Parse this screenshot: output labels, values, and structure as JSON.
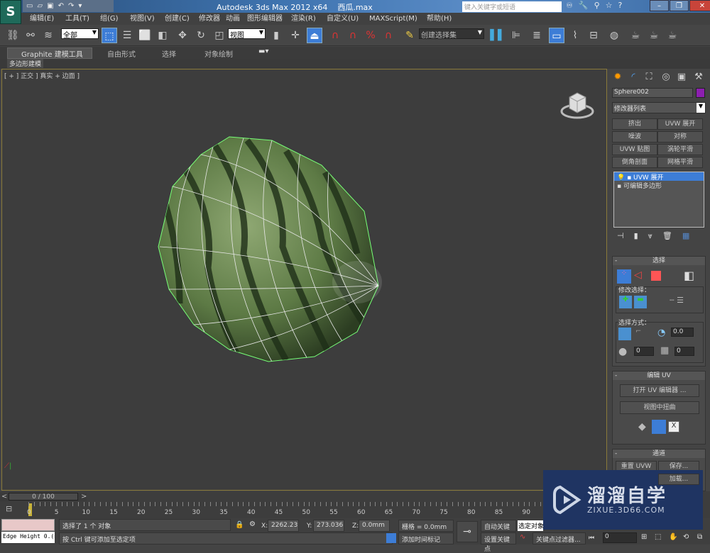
{
  "titlebar": {
    "title": "Autodesk 3ds Max  2012 x64",
    "file": "西瓜.max",
    "search_placeholder": "键入关键字或短语",
    "app_icon": "S"
  },
  "menu": [
    "编辑(E)",
    "工具(T)",
    "组(G)",
    "视图(V)",
    "创建(C)",
    "修改器",
    "动画",
    "图形编辑器",
    "渲染(R)",
    "自定义(U)",
    "MAXScript(M)",
    "帮助(H)"
  ],
  "toolbar": {
    "selection_filter": "全部",
    "reference_coord": "视图",
    "named_selection": "创建选择集"
  },
  "ribbon": {
    "tabs": [
      "Graphite 建模工具",
      "自由形式",
      "选择",
      "对象绘制"
    ],
    "subtab": "多边形建模"
  },
  "viewport": {
    "label": "[ + ] 正交 ] 真实 + 边面 ]"
  },
  "command_panel": {
    "object_name": "Sphere002",
    "object_color": "#8c1fb0",
    "modifier_list": "修改器列表",
    "modifier_buttons": [
      "挤出",
      "UVW 展开",
      "噪波",
      "对称",
      "UVW 贴图",
      "涡轮平滑",
      "倒角剖面",
      "网格平滑"
    ],
    "stack": [
      {
        "label": "UVW 展开",
        "selected": true
      },
      {
        "label": "可编辑多边形",
        "selected": false
      }
    ],
    "selection": {
      "title": "选择",
      "modify_label": "修改选择：",
      "method_label": "选择方式：",
      "angle": "0.0",
      "spin1": "0",
      "spin2": "0"
    },
    "edit_uv": {
      "title": "编辑 UV",
      "open_editor": "打开 UV 编辑器 ...",
      "tweak": "视图中扭曲"
    },
    "channel": {
      "title": "通道",
      "reset": "重置 UVW",
      "save": "保存...",
      "load": "加载..."
    }
  },
  "timeline": {
    "frame": "0 / 100",
    "prev": "<",
    "next": ">",
    "ticks": [
      "0",
      "5",
      "10",
      "15",
      "20",
      "25",
      "30",
      "35",
      "40",
      "45",
      "50",
      "55",
      "60",
      "65",
      "70",
      "75",
      "80",
      "85",
      "90"
    ]
  },
  "status": {
    "script_text": "Edge Height 0.(",
    "message": "选择了 1 个 对象",
    "hint": "按 Ctrl 键可添加至选定项",
    "x": "2262.239m",
    "y": "273.036mm",
    "z": "0.0mm",
    "grid": "栅格 = 0.0mm",
    "add_time_tag": "添加时间标记",
    "auto_key": "自动关键点",
    "set_key": "设置关键点",
    "key_mode": "选定对象",
    "key_filters": "关键点过滤器...",
    "frame_value": "0"
  },
  "watermark": {
    "brand": "溜溜自学",
    "url": "ZIXUE.3D66.COM"
  }
}
